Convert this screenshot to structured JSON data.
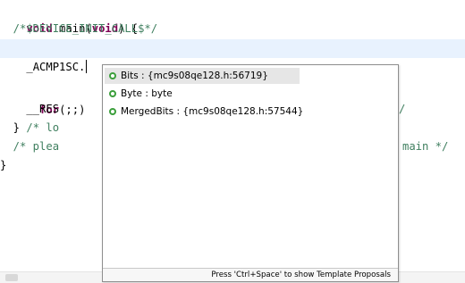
{
  "editor": {
    "lines": [
      "void main(void) {",
      "  /*$DEVICE_INIT_CALL$*/",
      "_ACMP1SC.",
      "",
      "  for(;;)",
      "    __RES",
      "  } /* lo",
      "  /* plea",
      "}"
    ],
    "line_fragments": {
      "trailing_comment_1": "/",
      "trailing_comment_2": "main */"
    }
  },
  "autocomplete": {
    "items": [
      {
        "label": "Bits : {mc9s08qe128.h:56719}",
        "icon": "field-icon",
        "selected": true
      },
      {
        "label": "Byte : byte",
        "icon": "field-icon",
        "selected": false
      },
      {
        "label": "MergedBits : {mc9s08qe128.h:57544}",
        "icon": "field-icon",
        "selected": false
      }
    ],
    "status_text": "Press 'Ctrl+Space' to show Template Proposals"
  },
  "colors": {
    "keyword": "#7f0055",
    "comment": "#3f7f5f",
    "current_line": "#e8f2fe",
    "field_icon": "#3c9f3c"
  }
}
